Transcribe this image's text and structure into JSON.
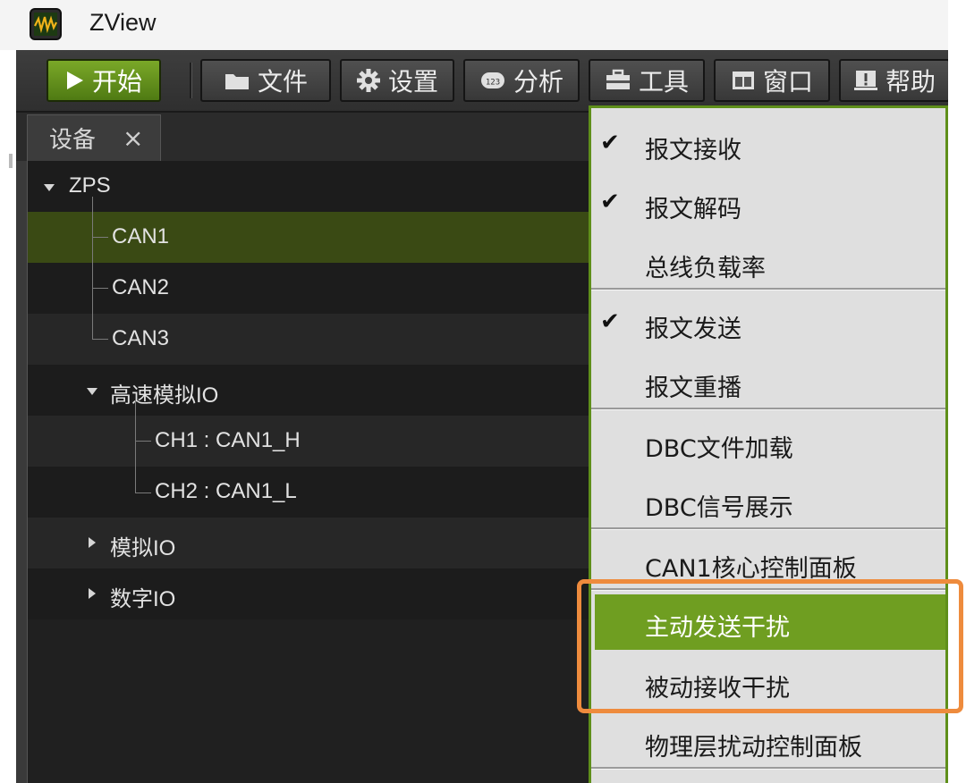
{
  "window": {
    "title": "ZView",
    "icon": "oscilloscope-app-icon"
  },
  "toolbar": {
    "start": {
      "label": "开始",
      "icon": "play-icon"
    },
    "file": {
      "label": "文件",
      "icon": "folder-icon"
    },
    "settings": {
      "label": "设置",
      "icon": "gear-icon"
    },
    "analysis": {
      "label": "分析",
      "icon": "analysis-icon"
    },
    "tools": {
      "label": "工具",
      "icon": "toolbox-icon"
    },
    "window": {
      "label": "窗口",
      "icon": "window-icon"
    },
    "help": {
      "label": "帮助",
      "icon": "help-icon"
    }
  },
  "tabs": {
    "devices": {
      "label": "设备",
      "close": "×"
    }
  },
  "tree": {
    "root": "ZPS",
    "can1": "CAN1",
    "can2": "CAN2",
    "can3": "CAN3",
    "hs_analog": "高速模拟IO",
    "ch1": "CH1 : CAN1_H",
    "ch2": "CH2 : CAN1_L",
    "analog": "模拟IO",
    "digital": "数字IO"
  },
  "menu": {
    "check_glyph": "✔",
    "items": [
      {
        "label": "报文接收",
        "checked": true
      },
      {
        "label": "报文解码",
        "checked": true
      },
      {
        "label": "总线负载率",
        "checked": false
      },
      {
        "label": "报文发送",
        "checked": true
      },
      {
        "label": "报文重播",
        "checked": false
      },
      {
        "label": "DBC文件加载",
        "checked": false
      },
      {
        "label": "DBC信号展示",
        "checked": false
      },
      {
        "label": "CAN1核心控制面板",
        "checked": false
      },
      {
        "label": "主动发送干扰",
        "checked": false,
        "highlighted": true
      },
      {
        "label": "被动接收干扰",
        "checked": false
      },
      {
        "label": "物理层扰动控制面板",
        "checked": false
      }
    ]
  },
  "colors": {
    "accent_green": "#6f9e21",
    "annotation_orange": "#ee8b3d",
    "toolbar_dark": "#3a3a3a",
    "menu_bg": "#dfdfdf"
  }
}
